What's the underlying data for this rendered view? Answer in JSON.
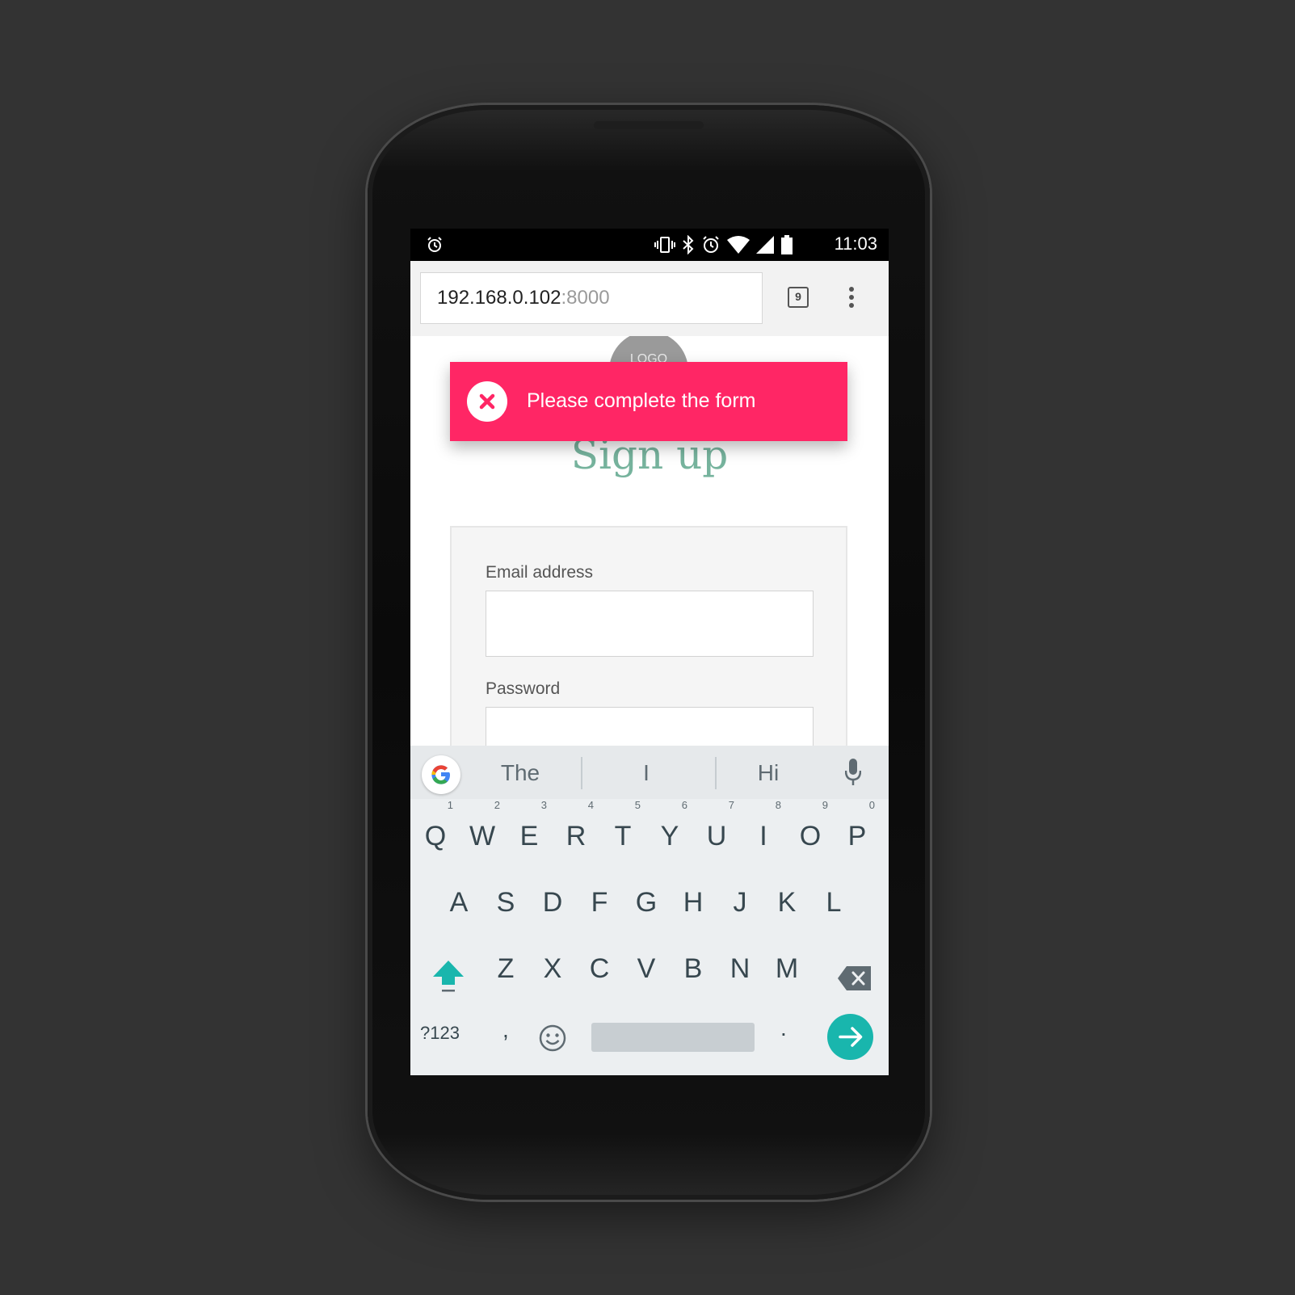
{
  "status_bar": {
    "time": "11:03",
    "left_icons": [
      "alarm-icon"
    ],
    "right_icons": [
      "vibrate-icon",
      "bluetooth-icon",
      "alarm-icon",
      "wifi-icon",
      "signal-icon",
      "battery-icon"
    ]
  },
  "browser": {
    "url_host": "192.168.0.102",
    "url_port": ":8000",
    "tab_count": "9",
    "menu_icon": "overflow-menu-icon"
  },
  "page": {
    "logo_text": "LOGO",
    "title": "Sign up",
    "toast": {
      "message": "Please complete the form",
      "icon": "close-circle-icon",
      "color": "#ff2665"
    },
    "form": {
      "email_label": "Email address",
      "email_value": "",
      "password_label": "Password",
      "password_value": ""
    },
    "title_color": "#76b39d"
  },
  "keyboard": {
    "suggestions": [
      "The",
      "I",
      "Hi"
    ],
    "row1": [
      {
        "key": "Q",
        "hint": "1"
      },
      {
        "key": "W",
        "hint": "2"
      },
      {
        "key": "E",
        "hint": "3"
      },
      {
        "key": "R",
        "hint": "4"
      },
      {
        "key": "T",
        "hint": "5"
      },
      {
        "key": "Y",
        "hint": "6"
      },
      {
        "key": "U",
        "hint": "7"
      },
      {
        "key": "I",
        "hint": "8"
      },
      {
        "key": "O",
        "hint": "9"
      },
      {
        "key": "P",
        "hint": "0"
      }
    ],
    "row2": [
      "A",
      "S",
      "D",
      "F",
      "G",
      "H",
      "J",
      "K",
      "L"
    ],
    "row3": [
      "Z",
      "X",
      "C",
      "V",
      "B",
      "N",
      "M"
    ],
    "symbols_label": "?123",
    "comma": ",",
    "period": ".",
    "accent_color": "#19b6ad"
  }
}
